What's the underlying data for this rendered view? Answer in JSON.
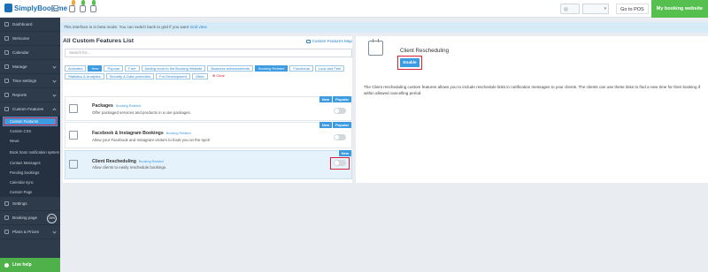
{
  "brand": {
    "name": "SimplyBook.me"
  },
  "topbar": {
    "badges": [
      "",
      "",
      ""
    ],
    "pos_label": "Go to POS",
    "website_label": "My booking website"
  },
  "sidebar": {
    "items": [
      {
        "label": "Dashboard"
      },
      {
        "label": "Welcome"
      },
      {
        "label": "Calendar"
      },
      {
        "label": "Manage"
      },
      {
        "label": "Time settings"
      },
      {
        "label": "Reports"
      },
      {
        "label": "Custom Features"
      }
    ],
    "subitems": [
      {
        "label": "Custom Features"
      },
      {
        "label": "Custom CSS"
      },
      {
        "label": "News"
      },
      {
        "label": "Book Soon notification system"
      },
      {
        "label": "Contact Messages"
      },
      {
        "label": "Pending bookings"
      },
      {
        "label": "Calendar sync"
      },
      {
        "label": "Custom Page"
      }
    ],
    "bottom_items": [
      {
        "label": "Settings"
      },
      {
        "label": "Booking page",
        "badge": "15%"
      },
      {
        "label": "Plans & Prices"
      }
    ],
    "live_help": "Live help"
  },
  "banner": {
    "text": "This interface is in beta mode. You can switch back to grid if you want",
    "link": "Grid view"
  },
  "list": {
    "title": "All Custom Features List",
    "map_link": "Custom Features Map",
    "search_placeholder": "Search for...",
    "filters": [
      {
        "label": "Activated",
        "selected": false
      },
      {
        "label": "New",
        "selected": true
      },
      {
        "label": "Popular",
        "selected": false
      },
      {
        "label": "Free",
        "selected": false
      },
      {
        "label": "Adding more to the Booking Website",
        "selected": false
      },
      {
        "label": "Business enhancements",
        "selected": false
      },
      {
        "label": "Booking Related",
        "selected": true
      },
      {
        "label": "Functional",
        "selected": false
      },
      {
        "label": "Look and Feel",
        "selected": false
      },
      {
        "label": "Statistics & Analytics",
        "selected": false
      },
      {
        "label": "Security & Data protection",
        "selected": false
      },
      {
        "label": "For Development",
        "selected": false
      },
      {
        "label": "Other",
        "selected": false
      }
    ],
    "clear_label": "Clear",
    "features": [
      {
        "name": "Packages",
        "tag": "Booking Related",
        "desc": "Offer packaged services and products in a one packages.",
        "badges": [
          "New",
          "Popular"
        ]
      },
      {
        "name": "Facebook & Instagram Bookings",
        "tag": "Booking Related",
        "desc": "Allow your Facebook and Instagram visitors to book you on the spot!",
        "badges": [
          "New",
          "Popular"
        ]
      },
      {
        "name": "Client Rescheduling",
        "tag": "Booking Related",
        "desc": "Allow clients to easily reschedule bookings.",
        "badges": [
          "New"
        ]
      }
    ]
  },
  "detail": {
    "title": "Client Rescheduling",
    "enable_label": "Enable",
    "description": "The Client rescheduling custom features allows you to include reschedule links in notification messages to your clients. The clients can use these links to find a new time for their booking if within allowed cancelling period."
  },
  "colors": {
    "accent": "#3c9be1",
    "sidebar": "#2e3b4b",
    "success": "#56c04f",
    "highlight": "#d9213a"
  }
}
